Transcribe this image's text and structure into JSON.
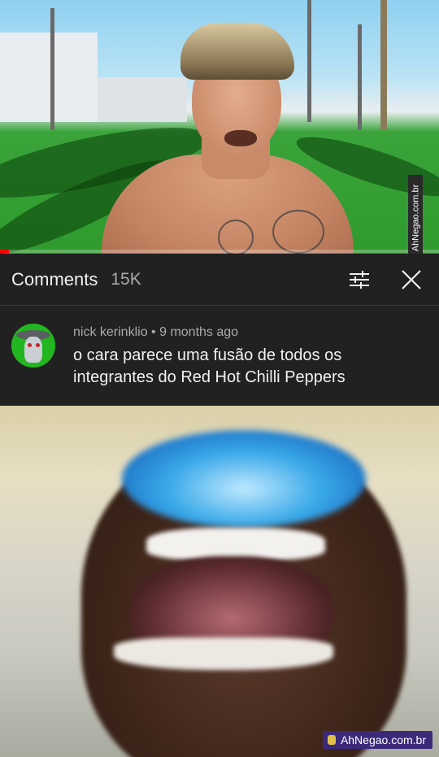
{
  "video": {
    "watermark": "AhNegao.com.br",
    "progress_fraction": 0.02,
    "progress_color": "#ff0000"
  },
  "comments_panel": {
    "title": "Comments",
    "count": "15K",
    "icons": [
      "sort-filter-icon",
      "close-icon"
    ]
  },
  "comment": {
    "author": "nick kerinklio",
    "separator": "•",
    "time": "9 months ago",
    "text": "o cara parece uma fusão de todos os integrantes do Red Hot Chilli Peppers",
    "avatar_color": "#22b61f"
  },
  "meme": {
    "watermark": "AhNegao.com.br"
  }
}
